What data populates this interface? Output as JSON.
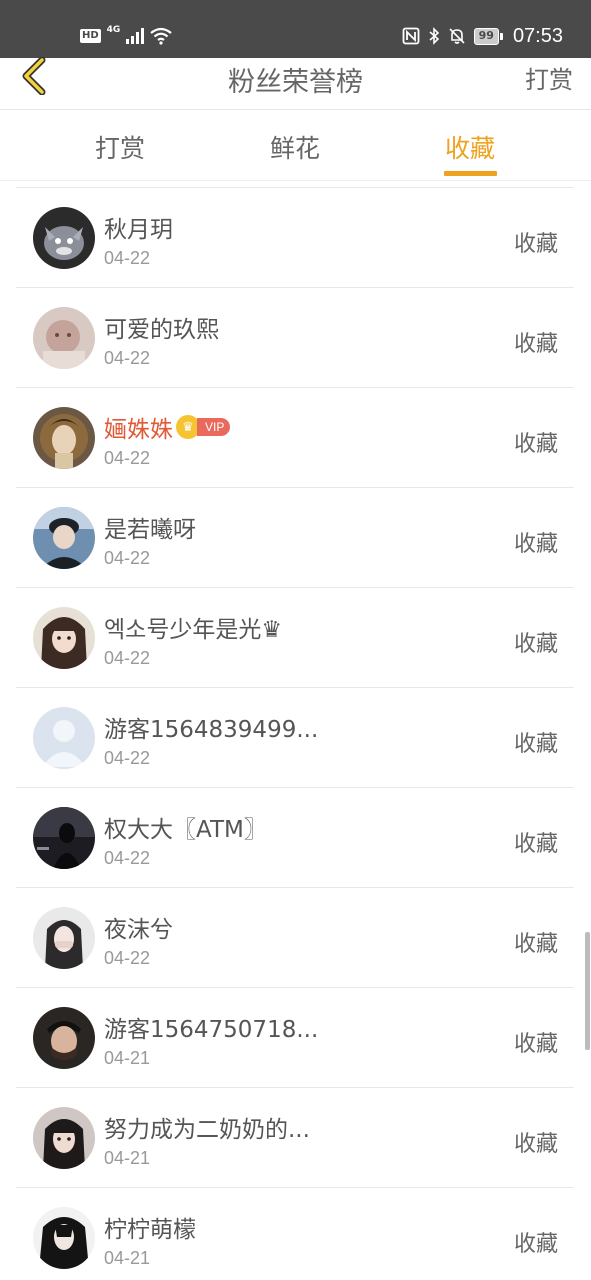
{
  "status_bar": {
    "hd": "HD",
    "network": "4G",
    "battery": "99",
    "time": "07:53"
  },
  "header": {
    "title": "粉丝荣誉榜",
    "action_label": "打赏"
  },
  "tabs": [
    {
      "label": "打赏",
      "active": false
    },
    {
      "label": "鲜花",
      "active": false
    },
    {
      "label": "收藏",
      "active": true
    }
  ],
  "colors": {
    "accent": "#eea21d",
    "vip_name": "#e15a38",
    "status_bar": "#4a4a4a"
  },
  "list": {
    "items": [
      {
        "name": "秋月玥",
        "date": "04-22",
        "action": "收藏",
        "vip": false
      },
      {
        "name": "可爱的玖熙",
        "date": "04-22",
        "action": "收藏",
        "vip": false
      },
      {
        "name": "婳姝姝",
        "date": "04-22",
        "action": "收藏",
        "vip": true,
        "vip_label": "VIP"
      },
      {
        "name": "是若曦呀",
        "date": "04-22",
        "action": "收藏",
        "vip": false
      },
      {
        "name": "엑소号少年是光♛",
        "date": "04-22",
        "action": "收藏",
        "vip": false
      },
      {
        "name": "游客1564839499...",
        "date": "04-22",
        "action": "收藏",
        "vip": false
      },
      {
        "name": "权大大〖ATM〗",
        "date": "04-22",
        "action": "收藏",
        "vip": false
      },
      {
        "name": "夜沫兮",
        "date": "04-22",
        "action": "收藏",
        "vip": false
      },
      {
        "name": "游客1564750718...",
        "date": "04-21",
        "action": "收藏",
        "vip": false
      },
      {
        "name": "努力成为二奶奶的...",
        "date": "04-21",
        "action": "收藏",
        "vip": false
      },
      {
        "name": "柠柠萌檬",
        "date": "04-21",
        "action": "收藏",
        "vip": false
      }
    ]
  }
}
